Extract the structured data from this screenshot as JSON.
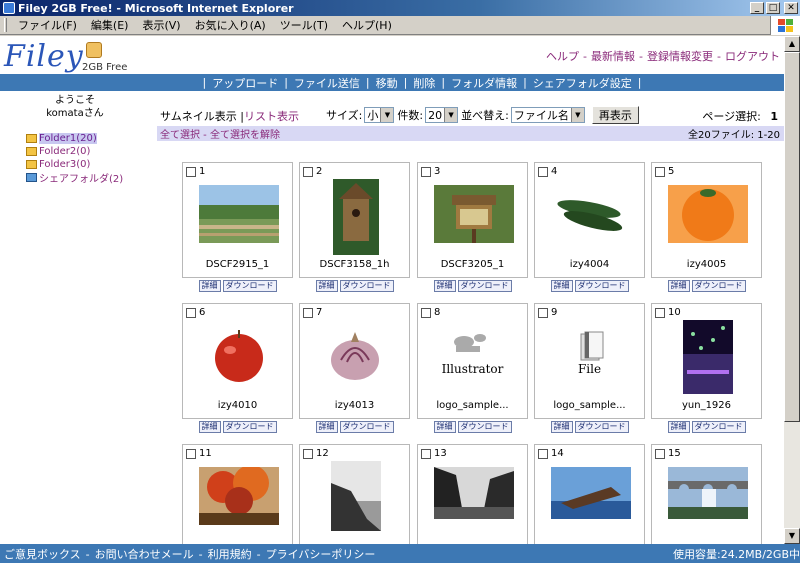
{
  "window": {
    "title": "Filey 2GB Free! - Microsoft Internet Explorer"
  },
  "menu": [
    "ファイル(F)",
    "編集(E)",
    "表示(V)",
    "お気に入り(A)",
    "ツール(T)",
    "ヘルプ(H)"
  ],
  "header": {
    "logo": "Filey",
    "logo_sub": "2GB Free",
    "links": [
      "ヘルプ",
      "最新情報",
      "登録情報変更",
      "ログアウト"
    ]
  },
  "nav": [
    "アップロード",
    "ファイル送信",
    "移動",
    "削除",
    "フォルダ情報",
    "シェアフォルダ設定"
  ],
  "sidebar": {
    "welcome": "ようこそ",
    "username": "komataさん",
    "folders": [
      {
        "label": "Folder1(20)",
        "selected": true
      },
      {
        "label": "Folder2(0)"
      },
      {
        "label": "Folder3(0)"
      },
      {
        "label": "シェアフォルダ(2)",
        "shared": true
      }
    ]
  },
  "toolbar": {
    "thumb_view": "サムネイル表示",
    "list_view": "リスト表示",
    "size_label": "サイズ:",
    "size_value": "小",
    "count_label": "件数:",
    "count_value": "20",
    "sort_label": "並べ替え:",
    "sort_value": "ファイル名",
    "refresh": "再表示",
    "page_label": "ページ選択:",
    "page_value": "1"
  },
  "selection": {
    "select_all": "全て選択",
    "deselect_all": "全て選択を解除",
    "summary": "全20ファイル: 1-20"
  },
  "card_buttons": {
    "detail": "詳細",
    "download": "ダウンロード"
  },
  "files": [
    {
      "num": "1",
      "name": "DSCF2915_1",
      "thumb": "landscape-photo"
    },
    {
      "num": "2",
      "name": "DSCF3158_1h",
      "thumb": "birdhouse-photo"
    },
    {
      "num": "3",
      "name": "DSCF3205_1",
      "thumb": "birdfeeder-photo"
    },
    {
      "num": "4",
      "name": "izy4004",
      "thumb": "cucumber-photo"
    },
    {
      "num": "5",
      "name": "izy4005",
      "thumb": "orange-photo"
    },
    {
      "num": "6",
      "name": "izy4010",
      "thumb": "apple-photo"
    },
    {
      "num": "7",
      "name": "izy4013",
      "thumb": "onion-photo"
    },
    {
      "num": "8",
      "name": "logo_sample...",
      "thumb": "illustrator-file-icon",
      "label": "Illustrator"
    },
    {
      "num": "9",
      "name": "logo_sample...",
      "thumb": "generic-file-icon",
      "label": "File"
    },
    {
      "num": "10",
      "name": "yun_1926",
      "thumb": "night-lights-photo"
    },
    {
      "num": "11",
      "name": "",
      "thumb": "autumn-tree-photo"
    },
    {
      "num": "12",
      "name": "",
      "thumb": "coast-bw-photo"
    },
    {
      "num": "13",
      "name": "",
      "thumb": "cave-bw-photo"
    },
    {
      "num": "14",
      "name": "",
      "thumb": "shipwreck-photo"
    },
    {
      "num": "15",
      "name": "",
      "thumb": "waterfall-bridge-photo"
    }
  ],
  "footer": {
    "links": [
      "ご意見ボックス",
      "お問い合わせメール",
      "利用規約",
      "プライバシーポリシー"
    ],
    "usage": "使用容量:24.2MB/2GB中"
  }
}
